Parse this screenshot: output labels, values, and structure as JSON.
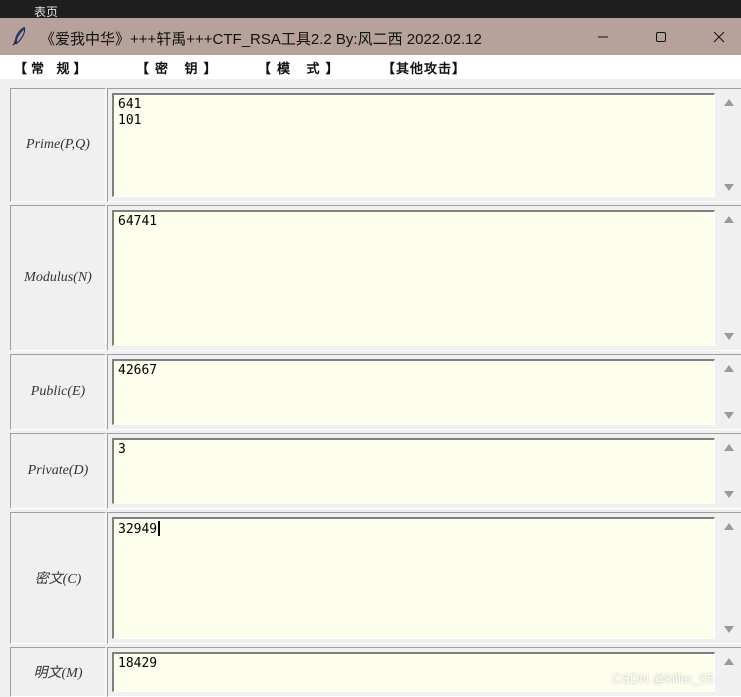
{
  "background": {
    "glyph": "表页"
  },
  "window": {
    "title": "《爱我中华》+++轩禹+++CTF_RSA工具2.2   By:风二西 2022.02.12",
    "icon": "feather-icon",
    "controls": {
      "minimize": "minimize-icon",
      "maximize": "maximize-icon",
      "close": "close-icon"
    },
    "titlebar_color": "#b6a29b"
  },
  "menu": [
    {
      "label": "【常  规】"
    },
    {
      "label": "【密  钥】"
    },
    {
      "label": "【模  式】"
    },
    {
      "label": "【其他攻击】"
    }
  ],
  "fields": [
    {
      "key": "prime",
      "label": "Prime(P,Q)",
      "value": "641\n101"
    },
    {
      "key": "modulus",
      "label": "Modulus(N)",
      "value": "64741"
    },
    {
      "key": "public",
      "label": "Public(E)",
      "value": "42667"
    },
    {
      "key": "private",
      "label": "Private(D)",
      "value": "3"
    },
    {
      "key": "ciphertext",
      "label": "密文(C)",
      "value": "32949"
    },
    {
      "key": "plaintext",
      "label": "明文(M)",
      "value": "18429"
    }
  ],
  "text_area_color": "#fefeec",
  "watermark": "CSDN @killer_05"
}
